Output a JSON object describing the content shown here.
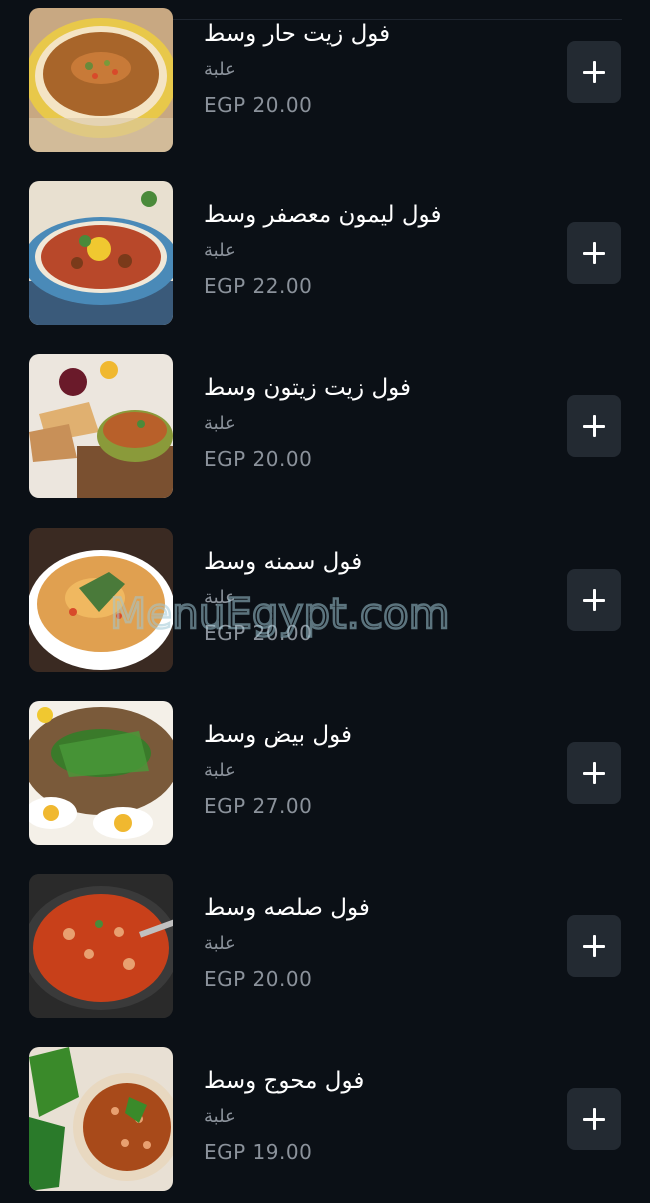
{
  "menu": {
    "items": [
      {
        "name": "فول زيت حار وسط",
        "description": "علبة",
        "price": "EGP 20.00",
        "add_label": "+",
        "image": "foul-spicy-oil-dish"
      },
      {
        "name": "فول ليمون معصفر وسط",
        "description": "علبة",
        "price": "EGP 22.00",
        "add_label": "+",
        "image": "foul-lemon-dish"
      },
      {
        "name": "فول زيت زيتون وسط",
        "description": "علبة",
        "price": "EGP 20.00",
        "add_label": "+",
        "image": "foul-olive-oil-dish"
      },
      {
        "name": "فول سمنه وسط",
        "description": "علبة",
        "price": "EGP 20.00",
        "add_label": "+",
        "image": "foul-ghee-dish"
      },
      {
        "name": "فول بيض وسط",
        "description": "علبة",
        "price": "EGP 27.00",
        "add_label": "+",
        "image": "foul-egg-dish"
      },
      {
        "name": "فول صلصه وسط",
        "description": "علبة",
        "price": "EGP 20.00",
        "add_label": "+",
        "image": "foul-tomato-sauce-dish"
      },
      {
        "name": "فول محوج وسط",
        "description": "علبة",
        "price": "EGP 19.00",
        "add_label": "+",
        "image": "foul-spiced-dish"
      }
    ]
  },
  "watermark": {
    "text": "MenuEgypt.com"
  },
  "colors": {
    "background": "#0b1016",
    "button": "#232a32",
    "muted_text": "#8b929b",
    "title_text": "#ffffff"
  }
}
